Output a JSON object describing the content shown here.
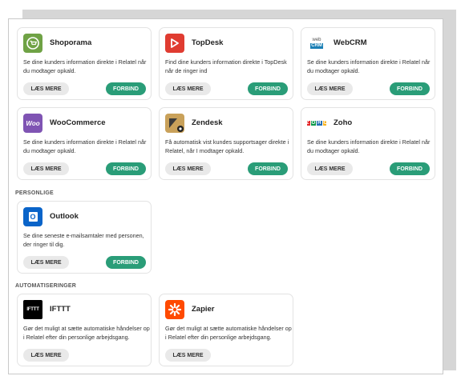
{
  "sections": {
    "personal": "PERSONLIGE",
    "automation": "AUTOMATISERINGER"
  },
  "buttons": {
    "read_more": "LÆS MERE",
    "connect": "FORBIND"
  },
  "cards": {
    "shoporama": {
      "title": "Shoporama",
      "description": "Se dine kunders information direkte i Relatel når du modtager opkald.",
      "logo_color": "#6fa245",
      "icon": "shopping-cart-icon"
    },
    "topdesk": {
      "title": "TopDesk",
      "description": "Find dine kunders information direkte i TopDesk når de ringer ind",
      "logo_color": "#e03c31",
      "icon": "topdesk-logo-icon"
    },
    "webcrm": {
      "title": "WebCRM",
      "description": "Se dine kunders information direkte i Relatel når du modtager opkald.",
      "logo_text_top": "web",
      "logo_text_bottom": "CRM",
      "logo_color": "#1a7fb5",
      "icon": "webcrm-logo-icon"
    },
    "woocommerce": {
      "title": "WooCommerce",
      "description": "Se dine kunders information direkte i Relatel når du modtager opkald.",
      "logo_text": "Woo",
      "logo_color": "#7f54b3",
      "icon": "woocommerce-logo-icon"
    },
    "zendesk": {
      "title": "Zendesk",
      "description": "Få automatisk vist kundes supportsager direkte i Relatel, når I modtager opkald.",
      "logo_color": "#c9a15a",
      "icon": "zendesk-logo-icon"
    },
    "zoho": {
      "title": "Zoho",
      "description": "Se dine kunders information direkte i Relatel når du modtager opkald.",
      "logo_letters": [
        "Z",
        "O",
        "H",
        "O"
      ],
      "icon": "zoho-logo-icon"
    },
    "outlook": {
      "title": "Outlook",
      "description": "Se dine seneste e-mailsamtaler med personen, der ringer til dig.",
      "logo_color": "#0a64c9",
      "logo_text": "O",
      "icon": "outlook-logo-icon"
    },
    "ifttt": {
      "title": "IFTTT",
      "description": "Gør det muligt at sætte automatiske håndelser op i Relatel efter din personlige arbejdsgang.",
      "logo_text": "IFTTT",
      "logo_color": "#000000",
      "icon": "ifttt-logo-icon"
    },
    "zapier": {
      "title": "Zapier",
      "description": "Gør det muligt at sætte automatiske håndelser op i Relatel efter din personlige arbejdsgang.",
      "logo_color": "#ff4a00",
      "icon": "zapier-logo-icon"
    }
  }
}
